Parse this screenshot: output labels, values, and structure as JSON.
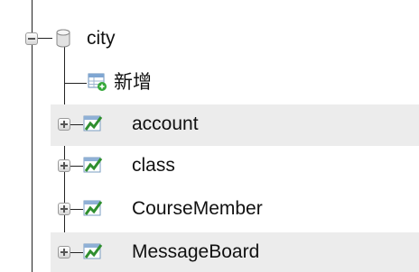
{
  "tree": {
    "database": {
      "label": "city",
      "icon": "database-icon"
    },
    "add_new": {
      "label": "新增",
      "icon": "add-table-icon"
    },
    "tables": [
      {
        "label": "account",
        "icon": "table-chart-icon",
        "highlight": true
      },
      {
        "label": "class",
        "icon": "table-chart-icon",
        "highlight": false
      },
      {
        "label": "CourseMember",
        "icon": "table-chart-icon",
        "highlight": false
      },
      {
        "label": "MessageBoard",
        "icon": "table-chart-icon",
        "highlight": true
      }
    ]
  }
}
